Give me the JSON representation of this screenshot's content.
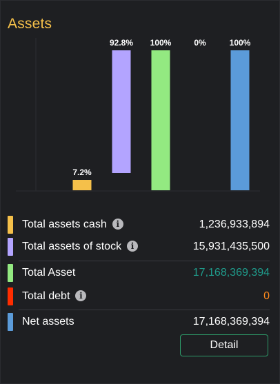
{
  "title": "Assets",
  "chart_data": {
    "type": "bar",
    "categories": [
      "Total assets cash",
      "Total assets of stock",
      "Total Asset",
      "Total debt",
      "Net assets"
    ],
    "values": [
      7.2,
      92.8,
      100,
      0,
      100
    ],
    "value_labels": [
      "7.2%",
      "92.8%",
      "100%",
      "0%",
      "100%"
    ],
    "colors": [
      "#f5c04a",
      "#b3a4ff",
      "#93e981",
      "#ff2d00",
      "#5b9bd9"
    ],
    "ylim": [
      0,
      100
    ],
    "title": "",
    "xlabel": "",
    "ylabel": "",
    "legend": "bottom",
    "grid": false
  },
  "legend": [
    {
      "label": "Total assets cash",
      "value": "1,236,933,894",
      "color": "#f5c04a",
      "info": true,
      "value_color": "#ffffff"
    },
    {
      "label": "Total assets of stock",
      "value": "15,931,435,500",
      "color": "#b3a4ff",
      "info": true,
      "value_color": "#ffffff"
    },
    {
      "label": "Total Asset",
      "value": "17,168,369,394",
      "color": "#93e981",
      "info": false,
      "value_color": "#1f9c8c"
    },
    {
      "label": "Total debt",
      "value": "0",
      "color": "#ff2d00",
      "info": true,
      "value_color": "#ff8a1c"
    },
    {
      "label": "Net assets",
      "value": "17,168,369,394",
      "color": "#5b9bd9",
      "info": false,
      "value_color": "#ffffff"
    }
  ],
  "info_glyph": "i",
  "detail_label": "Detail"
}
